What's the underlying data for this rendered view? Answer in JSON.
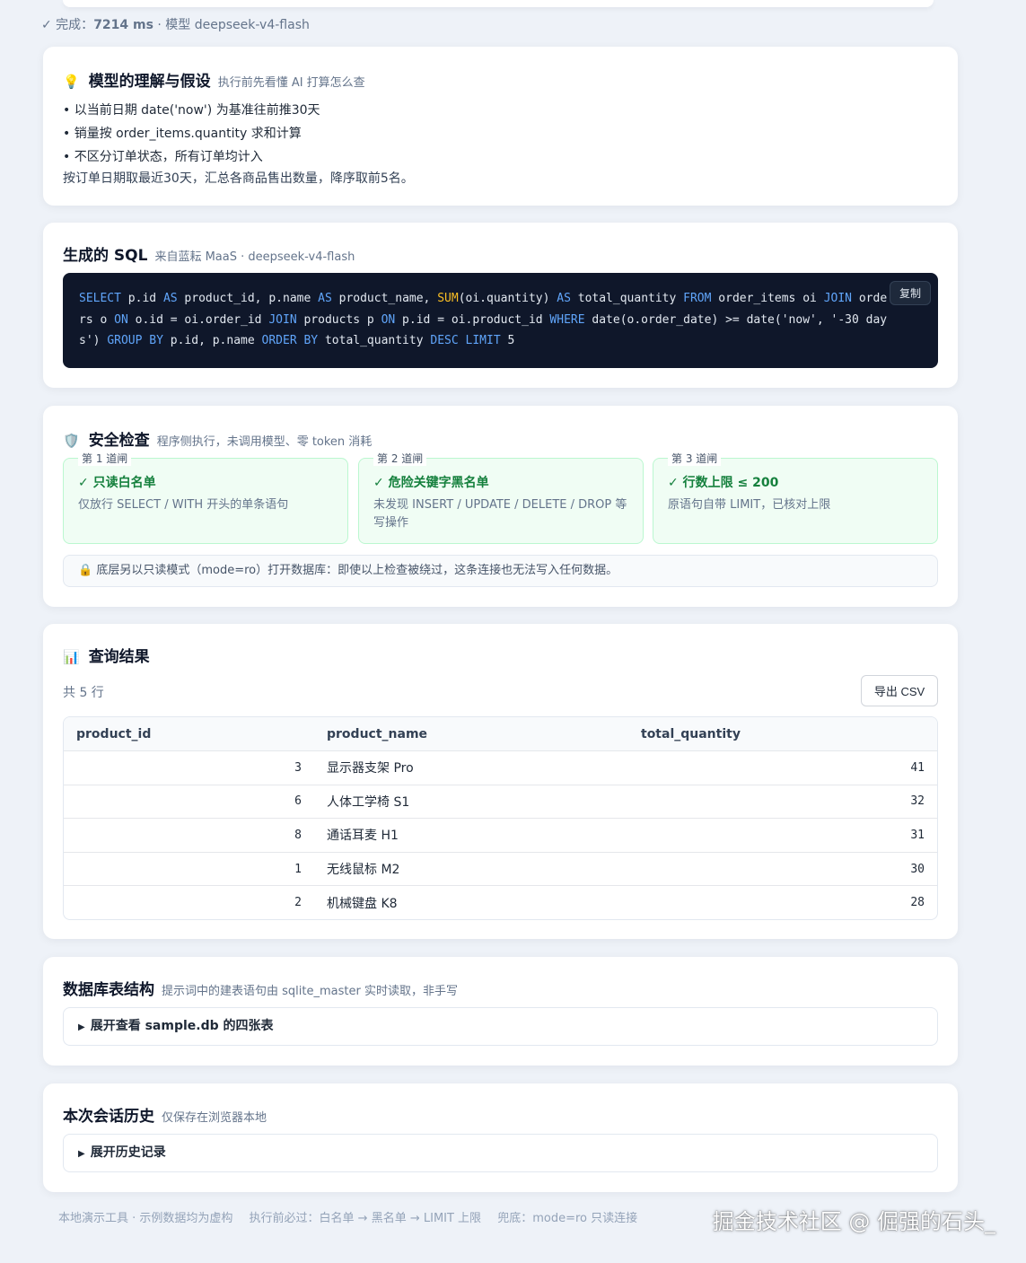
{
  "status": {
    "prefix": "✓ 完成：",
    "duration": "7214 ms",
    "model_text": "· 模型 deepseek-v4-flash"
  },
  "understanding": {
    "icon": "💡",
    "title": "模型的理解与假设",
    "subtitle": "执行前先看懂 AI 打算怎么查",
    "assumptions": [
      "以当前日期 date('now') 为基准往前推30天",
      "销量按 order_items.quantity 求和计算",
      "不区分订单状态，所有订单均计入"
    ],
    "summary": "按订单日期取最近30天，汇总各商品售出数量，降序取前5名。"
  },
  "sql": {
    "title": "生成的 SQL",
    "subtitle": "来自蓝耘 MaaS · deepseek-v4-flash",
    "copy_label": "复制",
    "tokens": [
      {
        "t": "SELECT",
        "k": "kw"
      },
      {
        "t": " p.id "
      },
      {
        "t": "AS",
        "k": "kw"
      },
      {
        "t": " product_id, p.name "
      },
      {
        "t": "AS",
        "k": "kw"
      },
      {
        "t": " product_name, "
      },
      {
        "t": "SUM",
        "k": "fn"
      },
      {
        "t": "(oi.quantity) "
      },
      {
        "t": "AS",
        "k": "kw"
      },
      {
        "t": " total_quantity "
      },
      {
        "t": "FROM",
        "k": "kw"
      },
      {
        "t": " order_items oi "
      },
      {
        "t": "JOIN",
        "k": "kw"
      },
      {
        "t": " orders o "
      },
      {
        "t": "ON",
        "k": "kw"
      },
      {
        "t": " o.id = oi.order_id "
      },
      {
        "t": "JOIN",
        "k": "kw"
      },
      {
        "t": " products p "
      },
      {
        "t": "ON",
        "k": "kw"
      },
      {
        "t": " p.id = oi.product_id "
      },
      {
        "t": "WHERE",
        "k": "kw"
      },
      {
        "t": " date(o.order_date) >= date('now', '-30 days') "
      },
      {
        "t": "GROUP BY",
        "k": "kw"
      },
      {
        "t": " p.id, p.name "
      },
      {
        "t": "ORDER BY",
        "k": "kw"
      },
      {
        "t": " total_quantity "
      },
      {
        "t": "DESC",
        "k": "kw"
      },
      {
        "t": " "
      },
      {
        "t": "LIMIT",
        "k": "kw"
      },
      {
        "t": " 5"
      }
    ]
  },
  "safety": {
    "icon": "🛡️",
    "title": "安全检查",
    "subtitle": "程序侧执行，未调用模型、零 token 消耗",
    "gates": [
      {
        "legend": "第 1 道闸",
        "title": "✓ 只读白名单",
        "desc": "仅放行 SELECT / WITH 开头的单条语句"
      },
      {
        "legend": "第 2 道闸",
        "title": "✓ 危险关键字黑名单",
        "desc": "未发现 INSERT / UPDATE / DELETE / DROP 等写操作"
      },
      {
        "legend": "第 3 道闸",
        "title": "✓ 行数上限 ≤ 200",
        "desc": "原语句自带 LIMIT，已核对上限"
      }
    ],
    "lock_icon": "🔒",
    "note": "底层另以只读模式（mode=ro）打开数据库：即使以上检查被绕过，这条连接也无法写入任何数据。"
  },
  "results": {
    "icon": "📊",
    "title": "查询结果",
    "row_count": "共 5 行",
    "export_label": "导出 CSV",
    "columns": [
      "product_id",
      "product_name",
      "total_quantity"
    ],
    "rows": [
      [
        "3",
        "显示器支架 Pro",
        "41"
      ],
      [
        "6",
        "人体工学椅 S1",
        "32"
      ],
      [
        "8",
        "通话耳麦 H1",
        "31"
      ],
      [
        "1",
        "无线鼠标 M2",
        "30"
      ],
      [
        "2",
        "机械键盘 K8",
        "28"
      ]
    ]
  },
  "schema": {
    "title": "数据库表结构",
    "subtitle": "提示词中的建表语句由 sqlite_master 实时读取，非手写",
    "toggle": "展开查看 sample.db 的四张表"
  },
  "history": {
    "title": "本次会话历史",
    "subtitle": "仅保存在浏览器本地",
    "toggle": "展开历史记录"
  },
  "footer": {
    "items": [
      "本地演示工具 · 示例数据均为虚构",
      "执行前必过：白名单 → 黑名单 → LIMIT 上限",
      "兜底：mode=ro 只读连接"
    ]
  },
  "watermark": "掘金技术社区 @ 倔强的石头_"
}
